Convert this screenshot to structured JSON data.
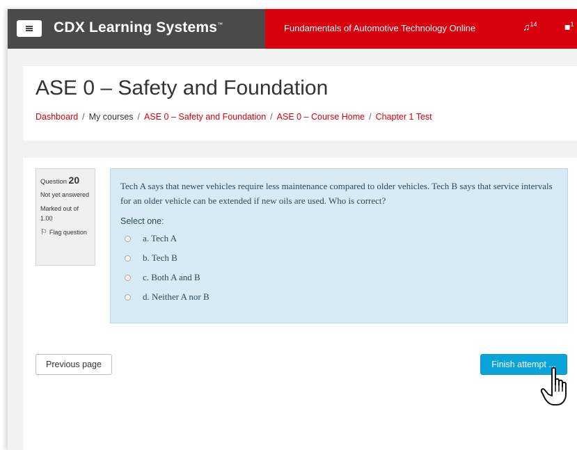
{
  "navbar": {
    "brand": "CDX Learning Systems",
    "brand_mark": "™",
    "course": "Fundamentals of Automotive Technology Online",
    "notification_count": "14",
    "message_count": "1"
  },
  "header": {
    "title": "ASE 0 – Safety and Foundation",
    "breadcrumb": [
      "Dashboard",
      "My courses",
      "ASE 0 – Safety and Foundation",
      "ASE 0 – Course Home",
      "Chapter 1 Test"
    ]
  },
  "question": {
    "label": "Question",
    "number": "20",
    "state": "Not yet answered",
    "marked": "Marked out of 1.00",
    "flag": "Flag question",
    "text": "Tech A says that newer vehicles require less maintenance compared to older vehicles. Tech B says that service intervals for an older vehicle can be extended if new oils are used. Who is correct?",
    "prompt": "Select one:",
    "answers": [
      "a. Tech A",
      "b. Tech B",
      "c. Both A and B",
      "d. Neither A nor B"
    ]
  },
  "nav": {
    "previous": "Previous page",
    "finish": "Finish attempt ..."
  },
  "colors": {
    "brand_red": "#d9000d",
    "nav_dark": "#4a4a4a",
    "question_bg": "#d8eaf4",
    "finish_blue": "#0aa4da"
  }
}
